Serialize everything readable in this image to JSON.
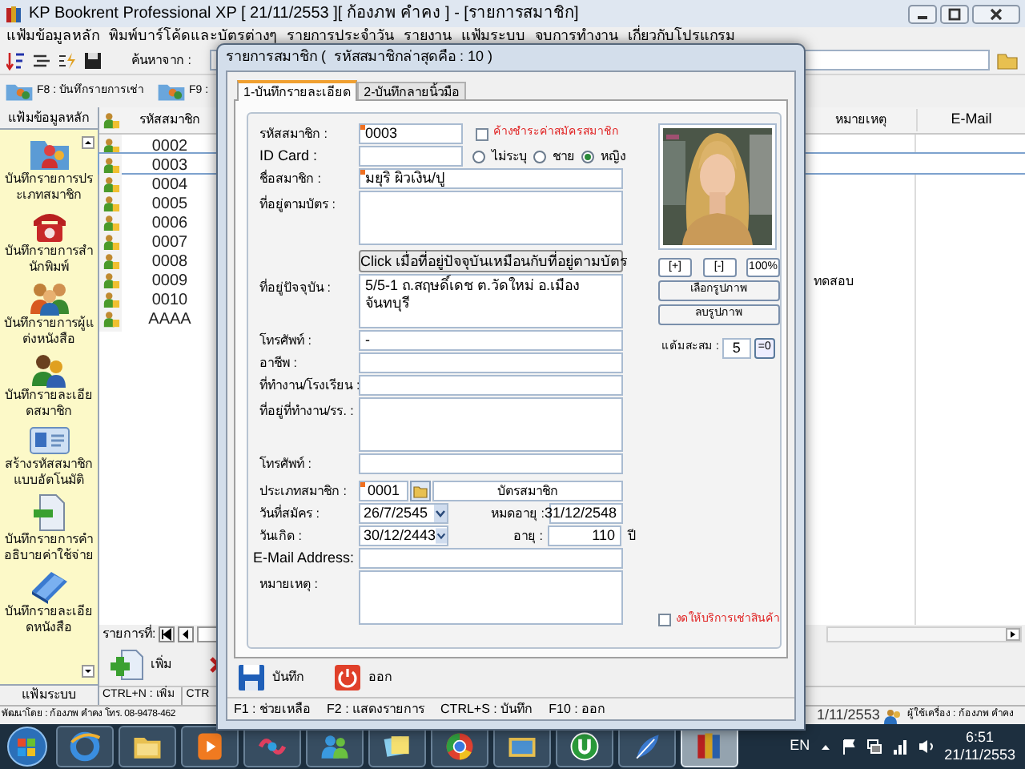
{
  "window": {
    "title": "KP Bookrent Professional XP [ 21/11/2553 ][ ก้องภพ คำคง ] - [รายการสมาชิก]"
  },
  "menu": [
    "แฟ้มข้อมูลหลัก",
    "พิมพ์บาร์โค้ดและบัตรต่างๆ",
    "รายการประจำวัน",
    "รายงาน",
    "แฟ้มระบบ",
    "จบการทำงาน",
    "เกี่ยวกับโปรแกรม"
  ],
  "toolbar": {
    "search_label": "ค้นหาจาก :"
  },
  "shortcuts": [
    "F8 : บันทึกรายการเช่า",
    "F9 :"
  ],
  "sidebar": {
    "header": "แฟ้มข้อมูลหลัก",
    "footer": "แฟ้มระบบ",
    "items": [
      {
        "kind": "folder",
        "label": "บันทึกรายการประเภทสมาชิก"
      },
      {
        "kind": "phone",
        "label": "บันทึกรายการสำนักพิมพ์"
      },
      {
        "kind": "people",
        "label": "บันทึกรายการผู้แต่งหนังสือ"
      },
      {
        "kind": "person",
        "label": "บันทึกรายละเอียดสมาชิก"
      },
      {
        "kind": "card",
        "label": "สร้างรหัสสมาชิกแบบอัตโนมัติ"
      },
      {
        "kind": "document",
        "label": "บันทึกรายการคำอธิบายค่าใช้จ่าย"
      },
      {
        "kind": "books",
        "label": "บันทึกรายละเอียดหนังสือ"
      }
    ]
  },
  "grid": {
    "columns": [
      "รหัสสมาชิก",
      "หมายเหตุ",
      "E-Mail"
    ],
    "rows": [
      {
        "code": "0002",
        "selected": false
      },
      {
        "code": "0003",
        "selected": true
      },
      {
        "code": "0004",
        "selected": false
      },
      {
        "code": "0005",
        "selected": false
      },
      {
        "code": "0006",
        "selected": false
      },
      {
        "code": "0007",
        "selected": false
      },
      {
        "code": "0008",
        "selected": false
      },
      {
        "code": "0009",
        "note": "ทดสอบ",
        "selected": false
      },
      {
        "code": "0010",
        "selected": false
      },
      {
        "code": "AAAA",
        "selected": false
      }
    ],
    "record_label": "รายการที่:",
    "add_button": "เพิ่ม",
    "shortcut_bar": [
      "CTRL+N : เพิ่ม",
      "CTR"
    ]
  },
  "status_bar": {
    "developer": "พัฒนาโดย : ก้องภพ คำคง โทร. 08-9478-462",
    "date": "1/11/2553",
    "user": "ผู้ใช้เครื่อง : ก้องภพ คำคง"
  },
  "dialog": {
    "title": "รายการสมาชิก (  รหัสสมาชิกล่าสุดคือ : 10 )",
    "tabs": [
      {
        "label": "1-บันทึกรายละเอียด",
        "selected": true
      },
      {
        "label": "2-บันทึกลายนิ้วมือ",
        "selected": false
      }
    ],
    "member_code": {
      "label": "รหัสสมาชิก :",
      "value": "0003",
      "required": true
    },
    "overdue": {
      "label": "ค้างชำระค่าสมัครสมาชิก",
      "checked": false
    },
    "id_card": {
      "label": "ID Card :"
    },
    "gender": [
      {
        "label": "ไม่ระบุ",
        "selected": false
      },
      {
        "label": "ชาย",
        "selected": false
      },
      {
        "label": "หญิง",
        "selected": true
      }
    ],
    "fields": [
      {
        "kind": "input",
        "label": "ชื่อสมาชิก :",
        "value": "มยุริ ผิวเงิน/ปู",
        "required": true
      },
      {
        "kind": "textarea",
        "label": "ที่อยู่ตามบัตร :"
      },
      {
        "kind": "button",
        "label": "Click เมื่อที่อยู่ปัจจุบันเหมือนกับที่อยู่ตามบัตร"
      },
      {
        "kind": "textarea",
        "label": "ที่อยู่ปัจจุบัน :",
        "value": "5/5-1 ถ.สฤษดิ์เดช ต.วัดใหม่ อ.เมือง จันทบุรี"
      },
      {
        "kind": "input",
        "label": "โทรศัพท์ :",
        "value": "-"
      },
      {
        "kind": "input",
        "label": "อาชีพ :"
      },
      {
        "kind": "input",
        "label": "ที่ทำงาน/โรงเรียน :"
      },
      {
        "kind": "textarea",
        "label": "ที่อยู่ที่ทำงาน/รร. :"
      },
      {
        "kind": "input",
        "label": "โทรศัพท์ :"
      },
      {
        "kind": "lookup",
        "label": "ประเภทสมาชิก :",
        "value": "0001",
        "description": "บัตรสมาชิก",
        "required": true
      },
      {
        "kind": "date",
        "label": "วันที่สมัคร :",
        "value": "26/7/2545",
        "side_label": "หมดอายุ :",
        "side_value": "31/12/2548"
      },
      {
        "kind": "date",
        "label": "วันเกิด :",
        "value": "30/12/2443",
        "side_label": "อายุ :",
        "side_value": "110",
        "unit": "ปี"
      },
      {
        "kind": "input",
        "label": "E-Mail Address:"
      },
      {
        "kind": "textarea",
        "label": "หมายเหตุ :"
      }
    ],
    "photo": {
      "kind": "picture"
    },
    "zoom_buttons": [
      "[+]",
      "[-]",
      "100%"
    ],
    "photo_buttons": [
      "เลือกรูปภาพ",
      "ลบรูปภาพ"
    ],
    "points": {
      "label": "แต้มสะสม :",
      "value": "5",
      "reset": "=0"
    },
    "suspend": {
      "label": "งดให้บริการเช่าสินค้า",
      "checked": false
    },
    "actions": [
      {
        "kind": "save",
        "label": "บันทึก"
      },
      {
        "kind": "exit",
        "label": "ออก"
      }
    ],
    "status": [
      "F1 : ช่วยเหลือ",
      "F2 : แสดงรายการ",
      "CTRL+S : บันทึก",
      "F10 : ออก"
    ]
  },
  "taskbar": {
    "language": "EN",
    "time": "6:51",
    "date": "21/11/2553"
  }
}
